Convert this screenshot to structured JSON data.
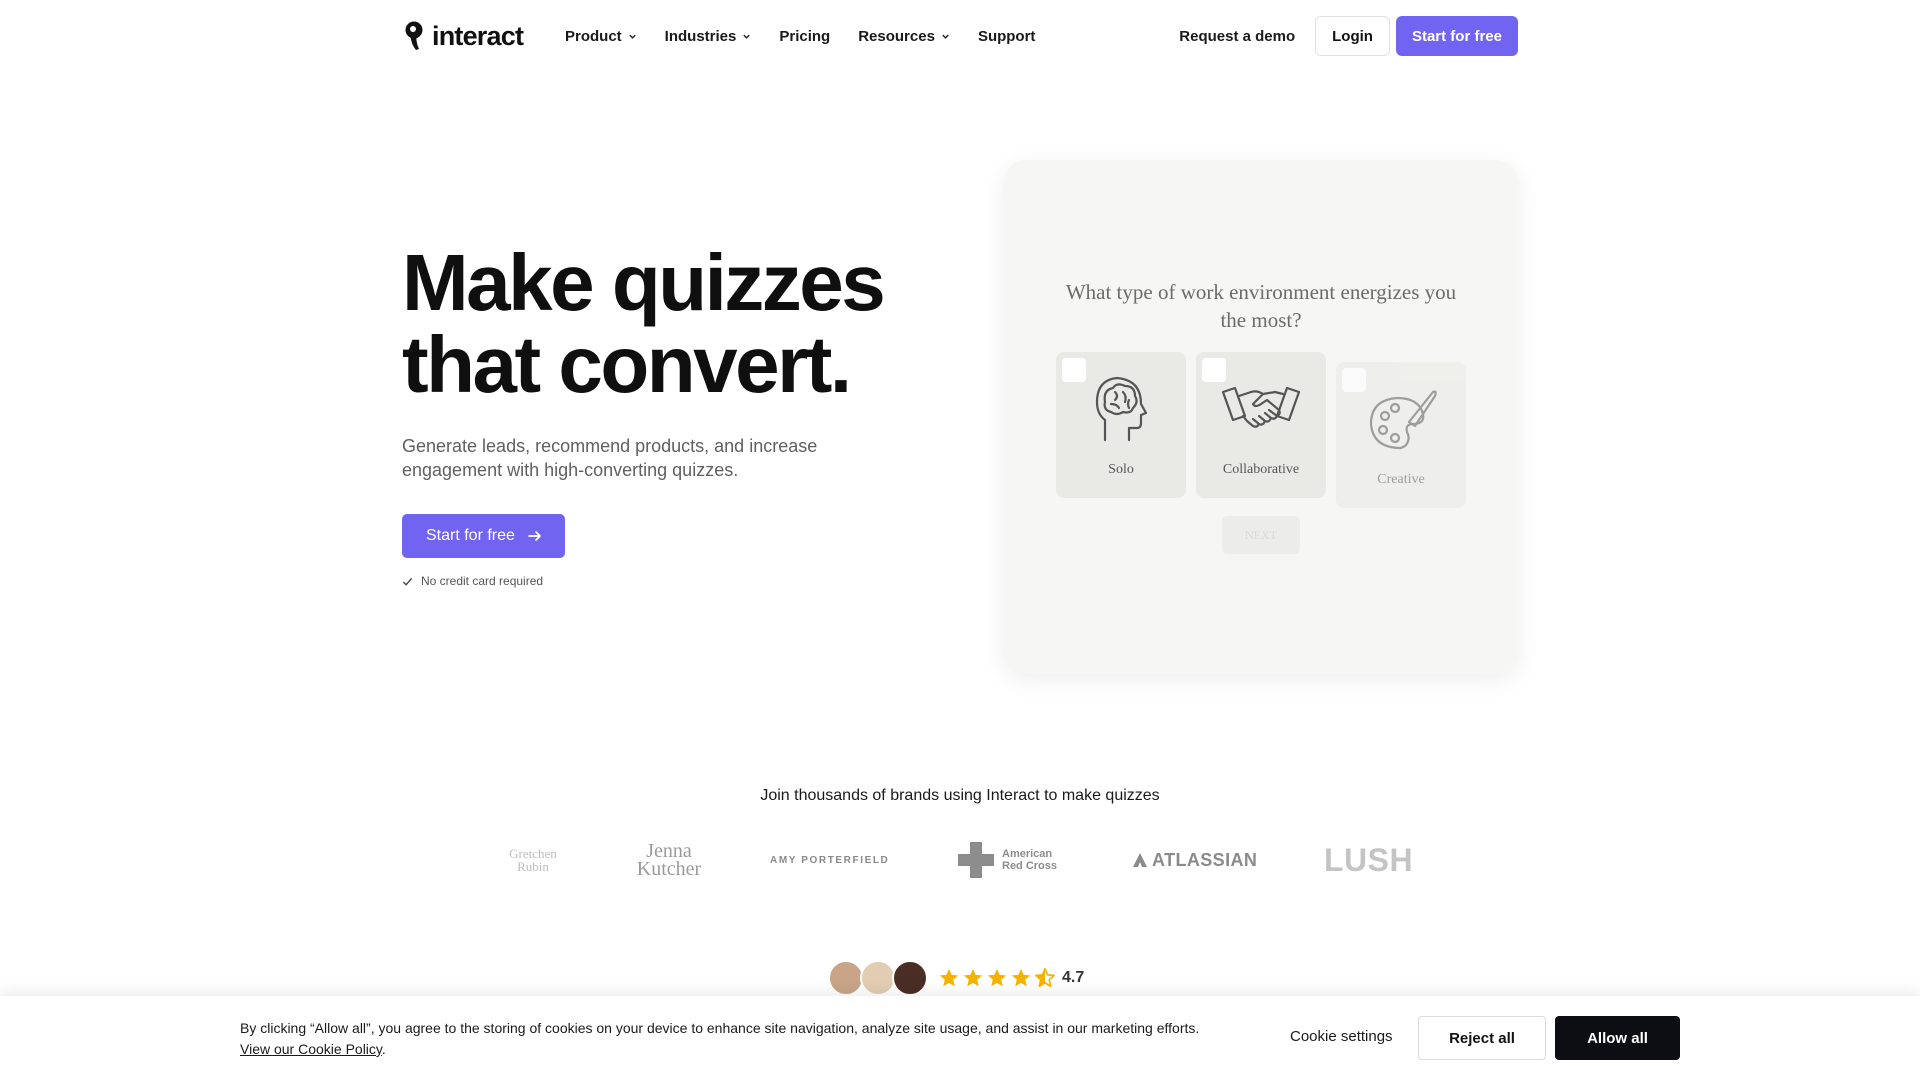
{
  "nav": {
    "logo_text": "interact",
    "links": [
      {
        "label": "Product",
        "dropdown": true
      },
      {
        "label": "Industries",
        "dropdown": true
      },
      {
        "label": "Pricing",
        "dropdown": false
      },
      {
        "label": "Resources",
        "dropdown": true
      },
      {
        "label": "Support",
        "dropdown": false
      }
    ],
    "request_demo": "Request a demo",
    "login": "Login",
    "start_free": "Start for free"
  },
  "hero": {
    "title_line1": "Make quizzes",
    "title_line2": "that convert.",
    "subtitle": "Generate leads, recommend products, and increase engagement with high-converting quizzes.",
    "cta": "Start for free",
    "note": "No credit card required"
  },
  "quiz": {
    "question": "What type of work environment energizes you the most?",
    "options": [
      {
        "label": "Solo",
        "icon": "head-brain-icon"
      },
      {
        "label": "Collaborative",
        "icon": "handshake-icon"
      },
      {
        "label": "Creative",
        "icon": "palette-icon"
      }
    ],
    "next": "NEXT"
  },
  "brands": {
    "title": "Join thousands of brands using Interact to make quizzes",
    "logos": {
      "gretchen_1": "Gretchen",
      "gretchen_2": "Rubin",
      "jenna_1": "Jenna",
      "jenna_2": "Kutcher",
      "amy": "AMY PORTERFIELD",
      "redcross_1": "American",
      "redcross_2": "Red Cross",
      "atlassian": "ATLASSIAN",
      "lush": "LUSH"
    }
  },
  "rating": {
    "value": "4.7",
    "stars": 4.5
  },
  "cookie": {
    "text": "By clicking “Allow all”, you agree to the storing of cookies on your device to enhance site navigation, analyze site usage, and assist in our marketing efforts.",
    "link": "View our Cookie Policy",
    "period": ".",
    "settings": "Cookie settings",
    "reject": "Reject all",
    "allow": "Allow all"
  },
  "colors": {
    "accent": "#7164f0",
    "dark_button": "#0d0d14",
    "star": "#f5b301"
  }
}
